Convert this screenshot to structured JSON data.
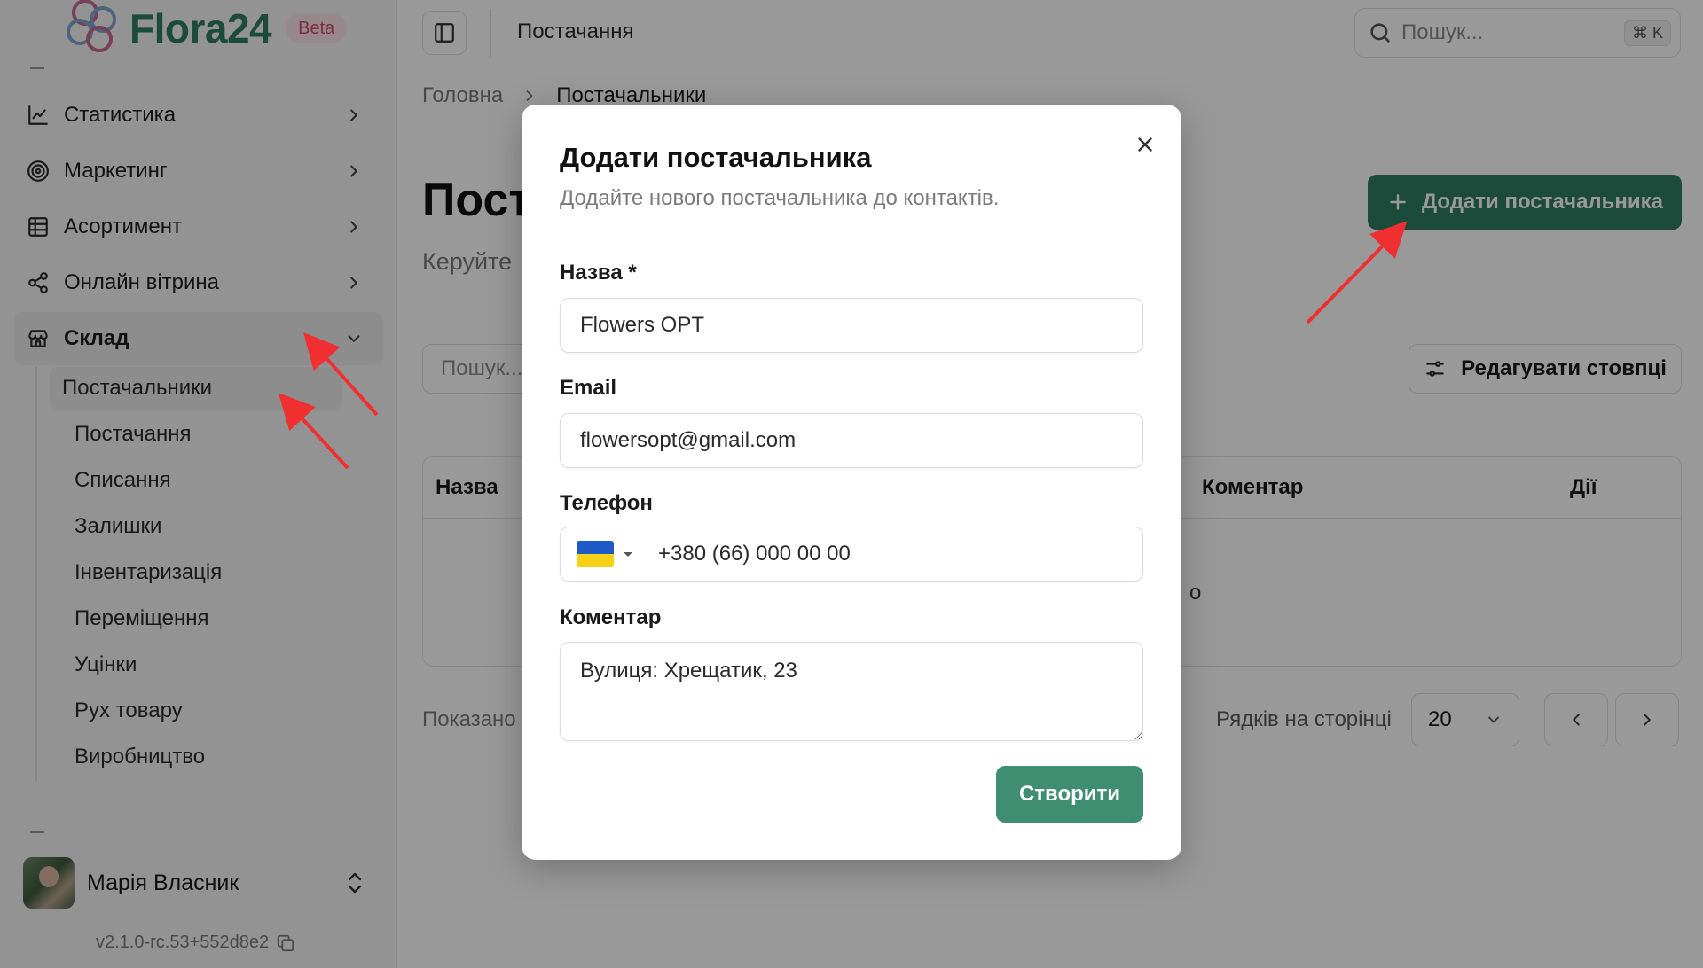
{
  "app": {
    "brand": "Flora24",
    "badge": "Beta",
    "version": "v2.1.0-rc.53+552d8e2",
    "accent_color": "#2f7d63",
    "annotation_color": "#f03030"
  },
  "sidebar": {
    "items": [
      {
        "label": "Статистика",
        "icon": "chart-line-icon"
      },
      {
        "label": "Маркетинг",
        "icon": "target-icon"
      },
      {
        "label": "Асортимент",
        "icon": "table-grid-icon"
      },
      {
        "label": "Онлайн вітрина",
        "icon": "share-icon"
      },
      {
        "label": "Склад",
        "icon": "store-icon",
        "expanded": true
      }
    ],
    "warehouse_items": [
      {
        "label": "Постачальники",
        "active": true
      },
      {
        "label": "Постачання"
      },
      {
        "label": "Списання"
      },
      {
        "label": "Залишки"
      },
      {
        "label": "Інвентаризація"
      },
      {
        "label": "Переміщення"
      },
      {
        "label": "Уцінки"
      },
      {
        "label": "Рух товару"
      },
      {
        "label": "Виробництво"
      }
    ],
    "user": {
      "name": "Марія Власник"
    }
  },
  "topbar": {
    "title": "Постачання",
    "search_placeholder": "Пошук...",
    "shortcut": "⌘ K"
  },
  "breadcrumb": {
    "home": "Головна",
    "current": "Постачальники"
  },
  "page": {
    "title_partial": "Пост",
    "subtitle_partial": "Керуйте",
    "add_button": "Додати постачальника",
    "search_partial": "Пошук...",
    "edit_columns": "Редагувати стовпці",
    "columns": [
      "Назва",
      "Коментар",
      "Дії"
    ],
    "empty_fragment": "о",
    "shown_partial": "Показано",
    "rows_per_page_label": "Рядків на сторінці",
    "rows_per_page": "20"
  },
  "modal": {
    "title": "Додати постачальника",
    "description": "Додайте нового постачальника до контактів.",
    "name_label": "Назва *",
    "name_value": "Flowers OPT",
    "email_label": "Email",
    "email_value": "flowersopt@gmail.com",
    "phone_label": "Телефон",
    "phone_value": "+380 (66) 000 00 00",
    "phone_country_flag": "ukraine-flag-icon",
    "comment_label": "Коментар",
    "comment_value": "Вулиця: Хрещатик, 23",
    "submit": "Створити"
  }
}
